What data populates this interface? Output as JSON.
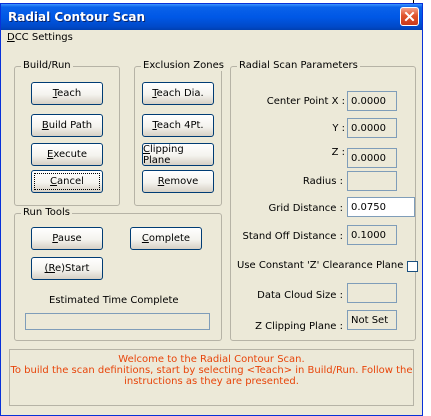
{
  "window": {
    "title": "Radial Contour Scan"
  },
  "menu": {
    "dcc_settings": "DCC Settings"
  },
  "build_run": {
    "legend": "Build/Run",
    "teach": "Teach",
    "build_path": "Build Path",
    "execute": "Execute",
    "cancel": "Cancel"
  },
  "exclusion": {
    "legend": "Exclusion Zones",
    "teach_dia": "Teach Dia.",
    "teach_4pt": "Teach 4Pt.",
    "clipping_plane": "Clipping Plane",
    "remove": "Remove"
  },
  "run_tools": {
    "legend": "Run Tools",
    "pause": "Pause",
    "complete": "Complete",
    "restart": "(Re)Start",
    "est_time_label": "Estimated Time Complete",
    "est_time_value": ""
  },
  "radial": {
    "legend": "Radial Scan Parameters",
    "center_x_label": "Center Point X :",
    "center_x": "0.0000",
    "y_label": "Y :",
    "y": "0.0000",
    "z_label": "Z :",
    "z": "0.0000",
    "radius_label": "Radius :",
    "radius": "",
    "grid_label": "Grid Distance :",
    "grid": "0.0750",
    "standoff_label": "Stand Off Distance :",
    "standoff": "0.1000",
    "constant_z_label": "Use Constant 'Z' Clearance Plane",
    "cloud_label": "Data Cloud Size :",
    "cloud": "",
    "clip_label": "Z Clipping Plane :",
    "clip": "Not Set"
  },
  "status": {
    "line1": "Welcome to the Radial Contour Scan.",
    "line2": "To build the scan definitions, start by selecting <Teach> in Build/Run.  Follow the",
    "line3": "instructions as they are presented."
  }
}
